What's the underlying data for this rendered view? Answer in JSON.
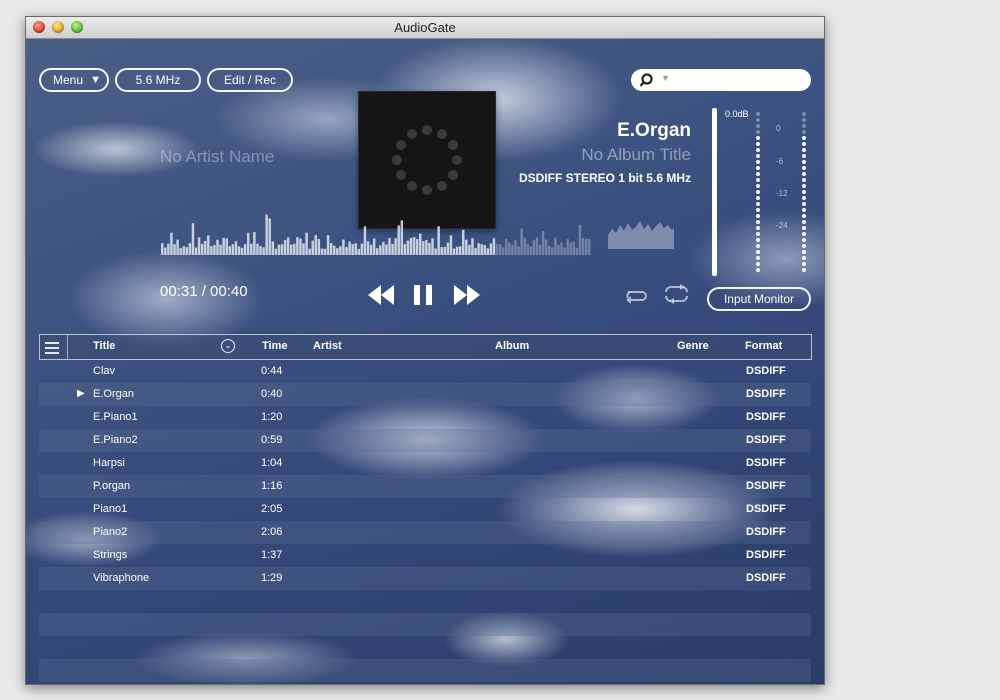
{
  "window": {
    "title": "AudioGate"
  },
  "toolbar": {
    "menu_label": "Menu",
    "menu_arrow": "▼",
    "sample_rate_label": "5.6 MHz",
    "edit_label": "Edit / Rec",
    "search_placeholder": ""
  },
  "now_playing": {
    "artist": "No Artist Name",
    "title": "E.Organ",
    "album": "No Album Title",
    "format": "DSDIFF STEREO 1 bit 5.6 MHz",
    "elapsed": "00:31",
    "total": "/ 00:40",
    "progress": 0.775
  },
  "meter": {
    "peak_label": "0.0dB",
    "scale": [
      "0",
      "-6",
      "-12",
      "-24"
    ],
    "input_monitor_label": "Input Monitor"
  },
  "playlist": {
    "columns": {
      "title": "Title",
      "time": "Time",
      "artist": "Artist",
      "album": "Album",
      "genre": "Genre",
      "format": "Format"
    },
    "playing_marker": "▶",
    "tracks": [
      {
        "title": "Clav",
        "time": "0:44",
        "format": "DSDIFF"
      },
      {
        "title": "E.Organ",
        "time": "0:40",
        "format": "DSDIFF"
      },
      {
        "title": "E.Piano1",
        "time": "1:20",
        "format": "DSDIFF"
      },
      {
        "title": "E.Piano2",
        "time": "0:59",
        "format": "DSDIFF"
      },
      {
        "title": "Harpsi",
        "time": "1:04",
        "format": "DSDIFF"
      },
      {
        "title": "P.organ",
        "time": "1:16",
        "format": "DSDIFF"
      },
      {
        "title": "Piano1",
        "time": "2:05",
        "format": "DSDIFF"
      },
      {
        "title": "Piano2",
        "time": "2:06",
        "format": "DSDIFF"
      },
      {
        "title": "Strings",
        "time": "1:37",
        "format": "DSDIFF"
      },
      {
        "title": "Vibraphone",
        "time": "1:29",
        "format": "DSDIFF"
      }
    ]
  }
}
